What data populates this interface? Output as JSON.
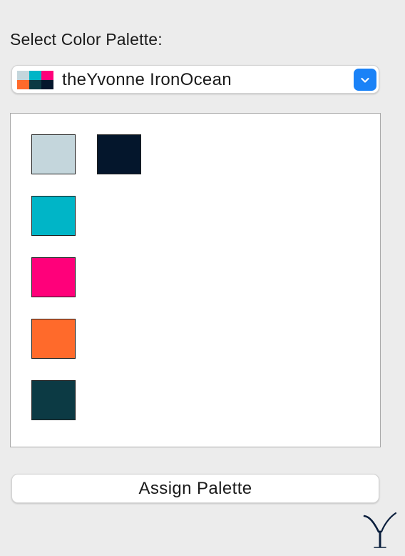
{
  "header": {
    "title": "Select Color Palette:"
  },
  "palette_select": {
    "selected": "theYvonne IronOcean",
    "icon_colors": [
      "#c4d6dc",
      "#00b5c7",
      "#ff007a",
      "#ff6a2b",
      "#0c3a44",
      "#04162c"
    ],
    "chevron_icon": "chevron-down-icon",
    "accent": "#1a82f7"
  },
  "swatches": [
    {
      "name": "light-gray-blue",
      "color": "#c4d6dc"
    },
    {
      "name": "navy",
      "color": "#04162c"
    },
    {
      "name": "cyan",
      "color": "#00b5c7"
    },
    {
      "name": "magenta",
      "color": "#ff007a"
    },
    {
      "name": "orange",
      "color": "#ff6a2b"
    },
    {
      "name": "dark-teal",
      "color": "#0c3a44"
    }
  ],
  "actions": {
    "assign_label": "Assign Palette"
  },
  "logo": {
    "name": "yvonne-logo-icon",
    "color": "#0a1e3c"
  }
}
